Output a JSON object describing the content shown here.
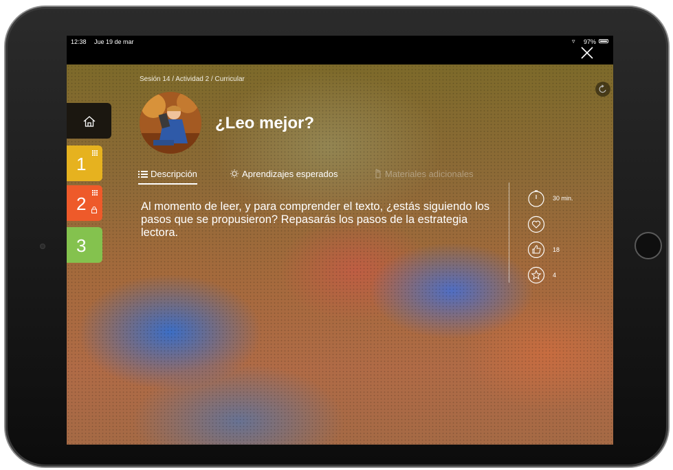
{
  "status_bar": {
    "time": "12:38",
    "date": "Jue 19 de mar",
    "battery": "97%"
  },
  "breadcrumb": "Sesión 14 / Actividad 2 / Curricular",
  "activity": {
    "title": "¿Leo mejor?",
    "description": "Al momento de leer, y para comprender el texto, ¿estás siguiendo los pasos que se propusieron? Repasarás los pasos de la estrategia lectora."
  },
  "tabs": [
    {
      "label": "Descripción",
      "icon": "list-icon",
      "active": true
    },
    {
      "label": "Aprendizajes esperados",
      "icon": "lightbulb-icon",
      "active": false
    },
    {
      "label": "Materiales adicionales",
      "icon": "hand-icon",
      "disabled": true
    }
  ],
  "stats": {
    "duration": "30 min.",
    "likes": "18",
    "stars": "4"
  },
  "sidebar": {
    "items": [
      {
        "label": "1",
        "color": "#e6b21f"
      },
      {
        "label": "2",
        "color": "#ee5a2a"
      },
      {
        "label": "3",
        "color": "#84c24e"
      }
    ]
  },
  "colors": {
    "home_bg": "#1b1710",
    "accent_text": "#ffffff"
  }
}
